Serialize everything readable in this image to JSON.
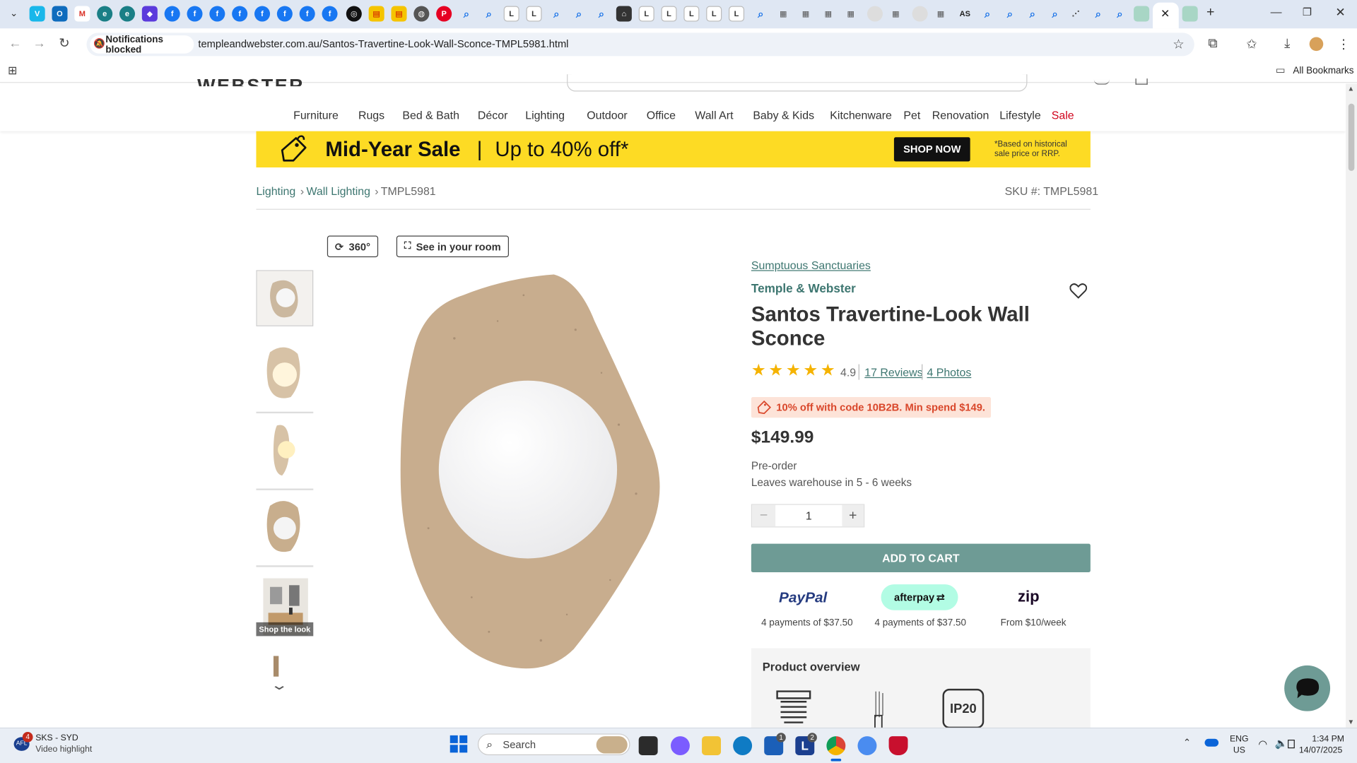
{
  "browser": {
    "url": "templeandwebster.com.au/Santos-Travertine-Look-Wall-Sconce-TMPL5981.html",
    "notification_chip": "Notifications blocked",
    "all_bookmarks": "All Bookmarks"
  },
  "site": {
    "logo": "WEBSTER",
    "nav": [
      "Furniture",
      "Rugs",
      "Bed & Bath",
      "Décor",
      "Lighting",
      "Outdoor",
      "Office",
      "Wall Art",
      "Baby & Kids",
      "Kitchenware",
      "Pet",
      "Renovation",
      "Lifestyle",
      "Sale"
    ]
  },
  "promo": {
    "title": "Mid-Year Sale",
    "sep": "|",
    "offer": "Up to 40% off*",
    "cta": "SHOP NOW",
    "note_line1": "*Based on historical",
    "note_line2": "sale price or RRP."
  },
  "breadcrumb": {
    "lighting": "Lighting",
    "sep1": "›",
    "wall_lighting": "Wall Lighting",
    "sep2": "›",
    "current": "TMPL5981",
    "sku": "SKU #: TMPL5981"
  },
  "gallery": {
    "btn_360": "360°",
    "btn_room": "See in your room",
    "shop_the_look": "Shop the look"
  },
  "product": {
    "collection": "Sumptuous Sanctuaries",
    "brand": "Temple & Webster",
    "title_line1": "Santos Travertine-Look Wall",
    "title_line2": "Sconce",
    "rating": "4.9",
    "rating_stars": 5,
    "reviews": "17 Reviews",
    "photos": "4 Photos",
    "promo_code": "10% off with code 10B2B. Min spend $149.",
    "price": "$149.99",
    "availability": "Pre-order",
    "shipping": "Leaves warehouse in 5 - 6 weeks",
    "quantity": "1",
    "add_to_cart": "ADD TO CART",
    "paypal_label": "PayPal",
    "paypal_sub": "4 payments of $37.50",
    "afterpay_label": "afterpay",
    "afterpay_sub": "4 payments of $37.50",
    "zip_label": "zip",
    "zip_sub": "From $10/week",
    "overview_title": "Product overview",
    "ip_rating": "IP20"
  },
  "taskbar": {
    "weather_badge": "4",
    "weather_title": "SKS - SYD",
    "weather_sub": "Video highlight",
    "search_placeholder": "Search",
    "lang1": "ENG",
    "lang2": "US",
    "time": "1:34 PM",
    "date": "14/07/2025",
    "badge_store": "1",
    "badge_l": "2"
  },
  "colors": {
    "brand_green": "#3d7670",
    "cart_green": "#6e9b95",
    "promo_yellow": "#fddb24",
    "sale_red": "#d0021b",
    "star": "#f5b301",
    "code_bg": "#fde3d8",
    "code_text": "#d9472b"
  },
  "tab_icons": [
    "vimeo-icon",
    "outlook-icon",
    "gmail-icon",
    "edge-icon",
    "facebook-icon",
    "pinterest-icon",
    "search-icon",
    "letter-l-icon"
  ]
}
